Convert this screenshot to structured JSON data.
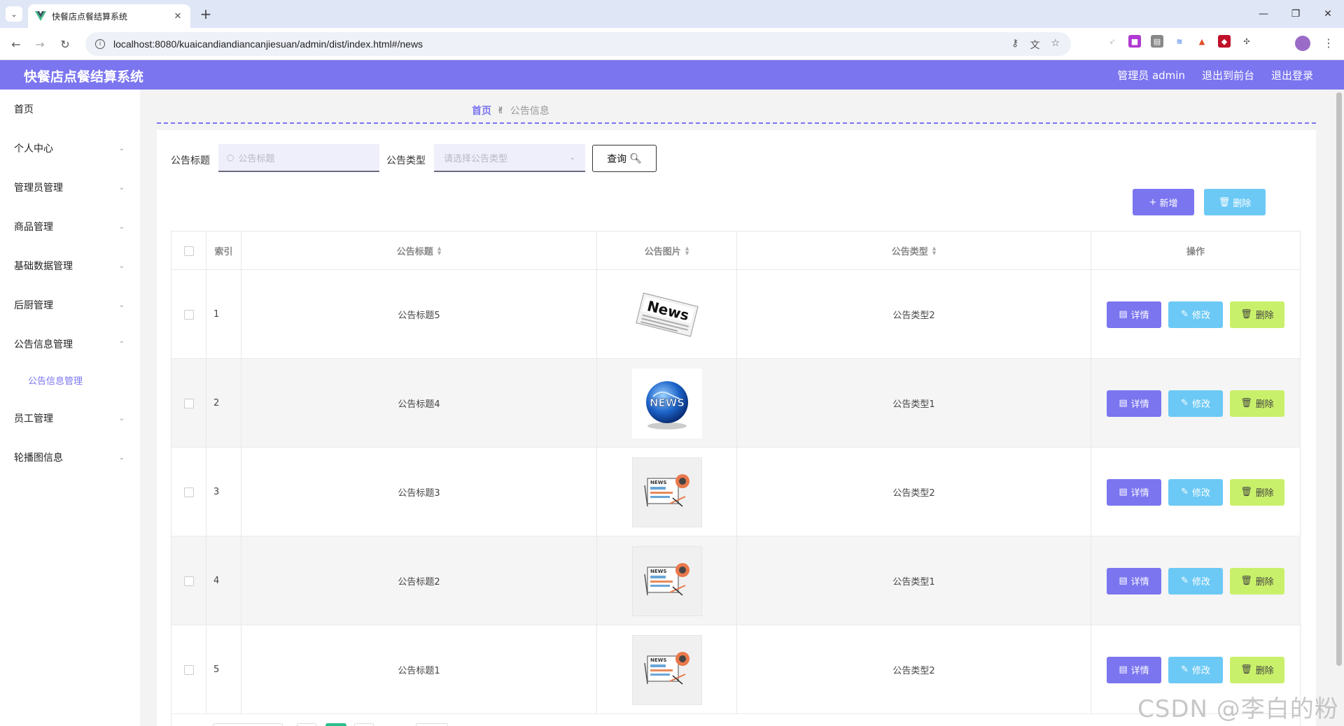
{
  "browser": {
    "tab_title": "快餐店点餐结算系统",
    "url": "localhost:8080/kuaicandiandiancanjiesuan/admin/dist/index.html#/news"
  },
  "header": {
    "title": "快餐店点餐结算系统",
    "links": [
      "管理员 admin",
      "退出到前台",
      "退出登录"
    ]
  },
  "sidebar": {
    "items": [
      {
        "label": "首页",
        "chevron": ""
      },
      {
        "label": "个人中心",
        "chevron": "⌄"
      },
      {
        "label": "管理员管理",
        "chevron": "⌄"
      },
      {
        "label": "商品管理",
        "chevron": "⌄"
      },
      {
        "label": "基础数据管理",
        "chevron": "⌄"
      },
      {
        "label": "后厨管理",
        "chevron": "⌄"
      },
      {
        "label": "公告信息管理",
        "chevron": "⌃"
      },
      {
        "label": "员工管理",
        "chevron": "⌄"
      },
      {
        "label": "轮播图信息",
        "chevron": "⌄"
      }
    ],
    "sub_item": "公告信息管理"
  },
  "breadcrumb": {
    "home": "首页",
    "current": "公告信息"
  },
  "search": {
    "title_label": "公告标题",
    "title_placeholder": "公告标题",
    "type_label": "公告类型",
    "type_placeholder": "请选择公告类型",
    "query_label": "查询"
  },
  "actions": {
    "add_label": "新增",
    "delete_label": "删除"
  },
  "table": {
    "headers": {
      "index": "索引",
      "title": "公告标题",
      "image": "公告图片",
      "type": "公告类型",
      "ops": "操作"
    },
    "rows": [
      {
        "index": "1",
        "title": "公告标题5",
        "type": "公告类型2",
        "image": "news-paper"
      },
      {
        "index": "2",
        "title": "公告标题4",
        "type": "公告类型1",
        "image": "news-globe"
      },
      {
        "index": "3",
        "title": "公告标题3",
        "type": "公告类型2",
        "image": "news-clip"
      },
      {
        "index": "4",
        "title": "公告标题2",
        "type": "公告类型1",
        "image": "news-clip"
      },
      {
        "index": "5",
        "title": "公告标题1",
        "type": "公告类型2",
        "image": "news-clip"
      }
    ],
    "op_labels": {
      "detail": "详情",
      "edit": "修改",
      "delete": "删除"
    }
  },
  "watermark": "CSDN @李白的粉",
  "colors": {
    "primary": "#7b75f0",
    "info": "#6cc9f5",
    "lime": "#c9f06a"
  }
}
